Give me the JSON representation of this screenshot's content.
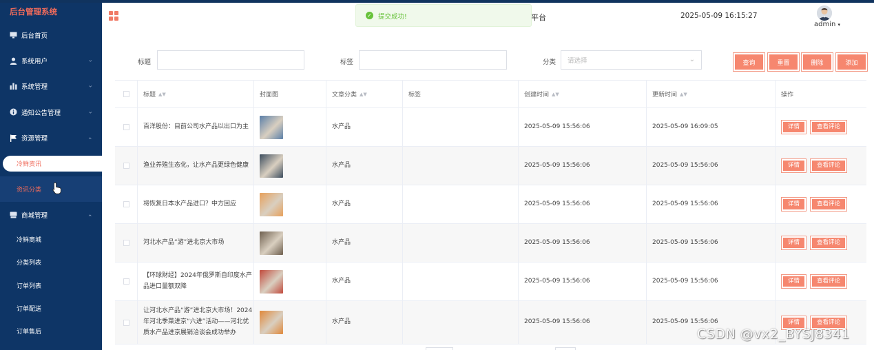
{
  "sidebar": {
    "brand": "后台管理系统",
    "items": [
      {
        "label": "后台首页",
        "icon": "monitor-icon"
      },
      {
        "label": "系统用户",
        "icon": "user-icon"
      },
      {
        "label": "系统管理",
        "icon": "bar-chart-icon"
      },
      {
        "label": "通知公告管理",
        "icon": "info-icon"
      },
      {
        "label": "资源管理",
        "icon": "flag-icon"
      }
    ],
    "resource_sub": [
      "冷鲜资讯",
      "资讯分类"
    ],
    "shop": {
      "label": "商城管理",
      "icon": "shop-icon"
    },
    "shop_sub": [
      "冷鲜商城",
      "分类列表",
      "订单列表",
      "订单配送",
      "订单售后"
    ]
  },
  "header": {
    "platform_title": "j平台",
    "datetime": "2025-05-09 16:15:27",
    "user": "admin"
  },
  "toast": {
    "message": "提交成功!"
  },
  "search": {
    "title_label": "标题",
    "title_value": "",
    "tag_label": "标签",
    "tag_value": "",
    "category_label": "分类",
    "category_placeholder": "请选择"
  },
  "buttons": {
    "query": "查询",
    "reset": "重置",
    "delete": "删除",
    "add": "添加"
  },
  "table": {
    "headers": {
      "title": "标题",
      "cover": "封面图",
      "category": "文章分类",
      "tag": "标签",
      "created": "创建时间",
      "updated": "更新时间",
      "actions": "操作"
    },
    "detail_label": "详情",
    "comments_label": "查看评论",
    "rows": [
      {
        "title": "百洋股份：目前公司水产品以出口为主",
        "category": "水产品",
        "tag": "",
        "created": "2025-05-09 15:56:06",
        "updated": "2025-05-09 16:09:05",
        "thumb_color": "#5a7fa8"
      },
      {
        "title": "渔业养殖生态化，让水产品更绿色健康",
        "category": "水产品",
        "tag": "",
        "created": "2025-05-09 15:56:06",
        "updated": "2025-05-09 15:56:06",
        "thumb_color": "#3c4d5e"
      },
      {
        "title": "将恢复日本水产品进口？中方回应",
        "category": "水产品",
        "tag": "",
        "created": "2025-05-09 15:56:06",
        "updated": "2025-05-09 15:56:06",
        "thumb_color": "#e7a05a"
      },
      {
        "title": "河北水产品“游”进北京大市场",
        "category": "水产品",
        "tag": "",
        "created": "2025-05-09 15:56:06",
        "updated": "2025-05-09 15:56:06",
        "thumb_color": "#6e5f4e"
      },
      {
        "title": "【环球财经】2024年俄罗斯自印度水产品进口量额双降",
        "category": "水产品",
        "tag": "",
        "created": "2025-05-09 15:56:06",
        "updated": "2025-05-09 15:56:06",
        "thumb_color": "#c14a3c"
      },
      {
        "title": "让河北水产品“游”进北京大市场！2024年河北季菜进京“六进”活动——河北优质水产品进京展销洽谈会成功举办",
        "category": "水产品",
        "tag": "",
        "created": "2025-05-09 15:56:06",
        "updated": "2025-05-09 15:56:06",
        "thumb_color": "#e0883a"
      }
    ]
  },
  "watermark": "CSDN @vx2_BYSJ8341"
}
